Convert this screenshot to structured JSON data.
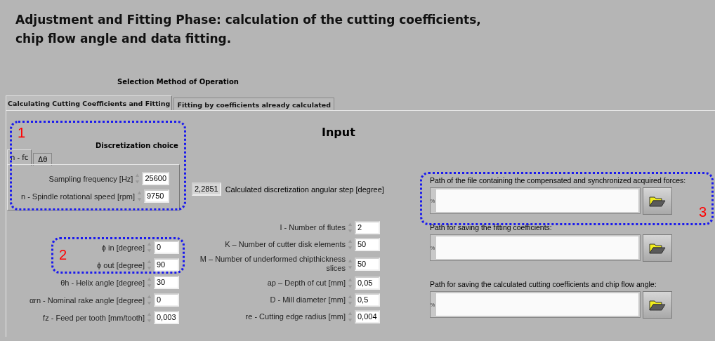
{
  "title_lines": [
    "Adjustment and Fitting Phase: calculation of the cutting coefficients,",
    "chip flow angle and data fitting."
  ],
  "selector": {
    "label": "Selection Method of Operation",
    "tabs": [
      {
        "label": "Calculating Cutting Coefficients and Fitting",
        "selected": true
      },
      {
        "label": "Fitting by coefficients already calculated",
        "selected": false
      }
    ]
  },
  "section_title": "Input",
  "discretization": {
    "label": "Discretization choice",
    "tabs": [
      {
        "label": "n - fc",
        "selected": true
      },
      {
        "label": "Δθ",
        "selected": false
      }
    ],
    "fields": [
      {
        "label": "Sampling frequency [Hz]",
        "value": "25600"
      },
      {
        "label": "n - Spindle rotational speed  [rpm]",
        "value": "9750"
      }
    ]
  },
  "calculated": {
    "value": "2,2851",
    "label": "Calculated discretization angular step [degree]"
  },
  "angles": [
    {
      "label": "ϕ in [degree]",
      "value": "0"
    },
    {
      "label": "ϕ out [degree]",
      "value": "90"
    }
  ],
  "left_params": [
    {
      "label": "θh - Helix angle [degree]",
      "value": "30"
    },
    {
      "label": "αrn - Nominal rake angle [degree]",
      "value": "0"
    },
    {
      "label": "fz - Feed per tooth [mm/tooth]",
      "value": "0,003"
    }
  ],
  "right_params": [
    {
      "label": "I - Number of flutes",
      "value": "2"
    },
    {
      "label": "K – Number of cutter disk elements",
      "value": "50"
    },
    {
      "label": "M – Number of underformed chipthickness slices",
      "value": "50"
    },
    {
      "label": "ap – Depth of cut [mm]",
      "value": "0,05"
    },
    {
      "label": "D - Mill diameter [mm]",
      "value": "0,5"
    },
    {
      "label": "re - Cutting edge radius [mm]",
      "value": "0,004"
    }
  ],
  "paths": [
    {
      "label": "Path of the file containing the compensated and synchronized acquired forces:",
      "indicator": "%"
    },
    {
      "label": "Path for saving the fitting coefficients:",
      "indicator": "%"
    },
    {
      "label": "Path for saving the calculated cutting coefficients and chip flow angle:",
      "indicator": "%"
    }
  ],
  "annotations": [
    {
      "number": "1"
    },
    {
      "number": "2"
    },
    {
      "number": "3"
    }
  ]
}
